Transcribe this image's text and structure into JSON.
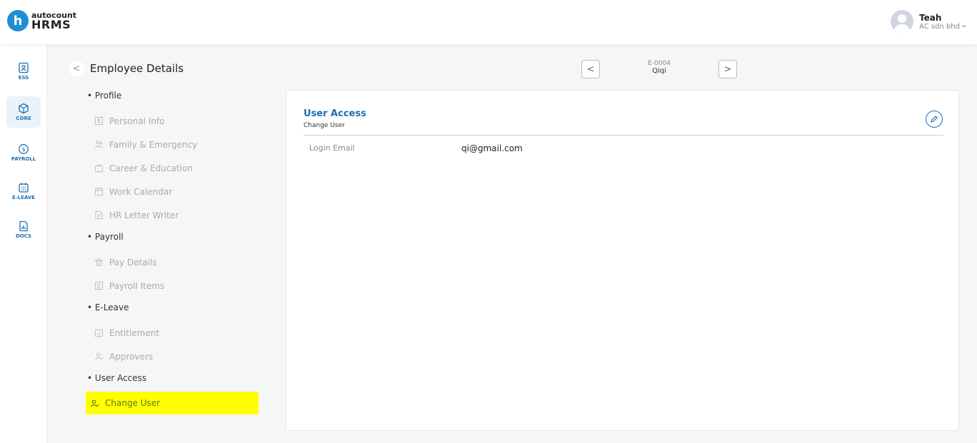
{
  "header": {
    "logo_mark": "h",
    "brand": "autocount",
    "product": "HRMS",
    "user_name": "Teah",
    "company": "AC sdn bhd"
  },
  "rail": {
    "items": [
      {
        "label": "ESS",
        "icon": "ess-icon"
      },
      {
        "label": "CORE",
        "icon": "core-icon"
      },
      {
        "label": "PAYROLL",
        "icon": "payroll-icon"
      },
      {
        "label": "E-LEAVE",
        "icon": "calendar-icon"
      },
      {
        "label": "DOCS",
        "icon": "docs-icon"
      }
    ],
    "active_item": "CORE"
  },
  "page": {
    "title": "Employee Details",
    "back_glyph": "<"
  },
  "pager": {
    "prev_glyph": "<",
    "next_glyph": ">",
    "employee_code": "E-0004",
    "employee_name": "Qiqi"
  },
  "nav": {
    "groups": [
      {
        "label": "Profile",
        "items": [
          "Personal Info",
          "Family & Emergency",
          "Career & Education",
          "Work Calendar",
          "HR Letter Writer"
        ]
      },
      {
        "label": "Payroll",
        "items": [
          "Pay Details",
          "Payroll Items"
        ]
      },
      {
        "label": "E-Leave",
        "items": [
          "Entitlement",
          "Approvers"
        ]
      },
      {
        "label": "User Access",
        "items": [
          "Change User"
        ]
      }
    ],
    "active_item": "Change User",
    "highlight_color": "#ffff00"
  },
  "card": {
    "title": "User Access",
    "subtitle": "Change User",
    "field_label": "Login Email",
    "field_value": "qi@gmail.com"
  },
  "colors": {
    "brand_blue": "#1f8fd1",
    "accent_blue": "#1f6fb0"
  }
}
